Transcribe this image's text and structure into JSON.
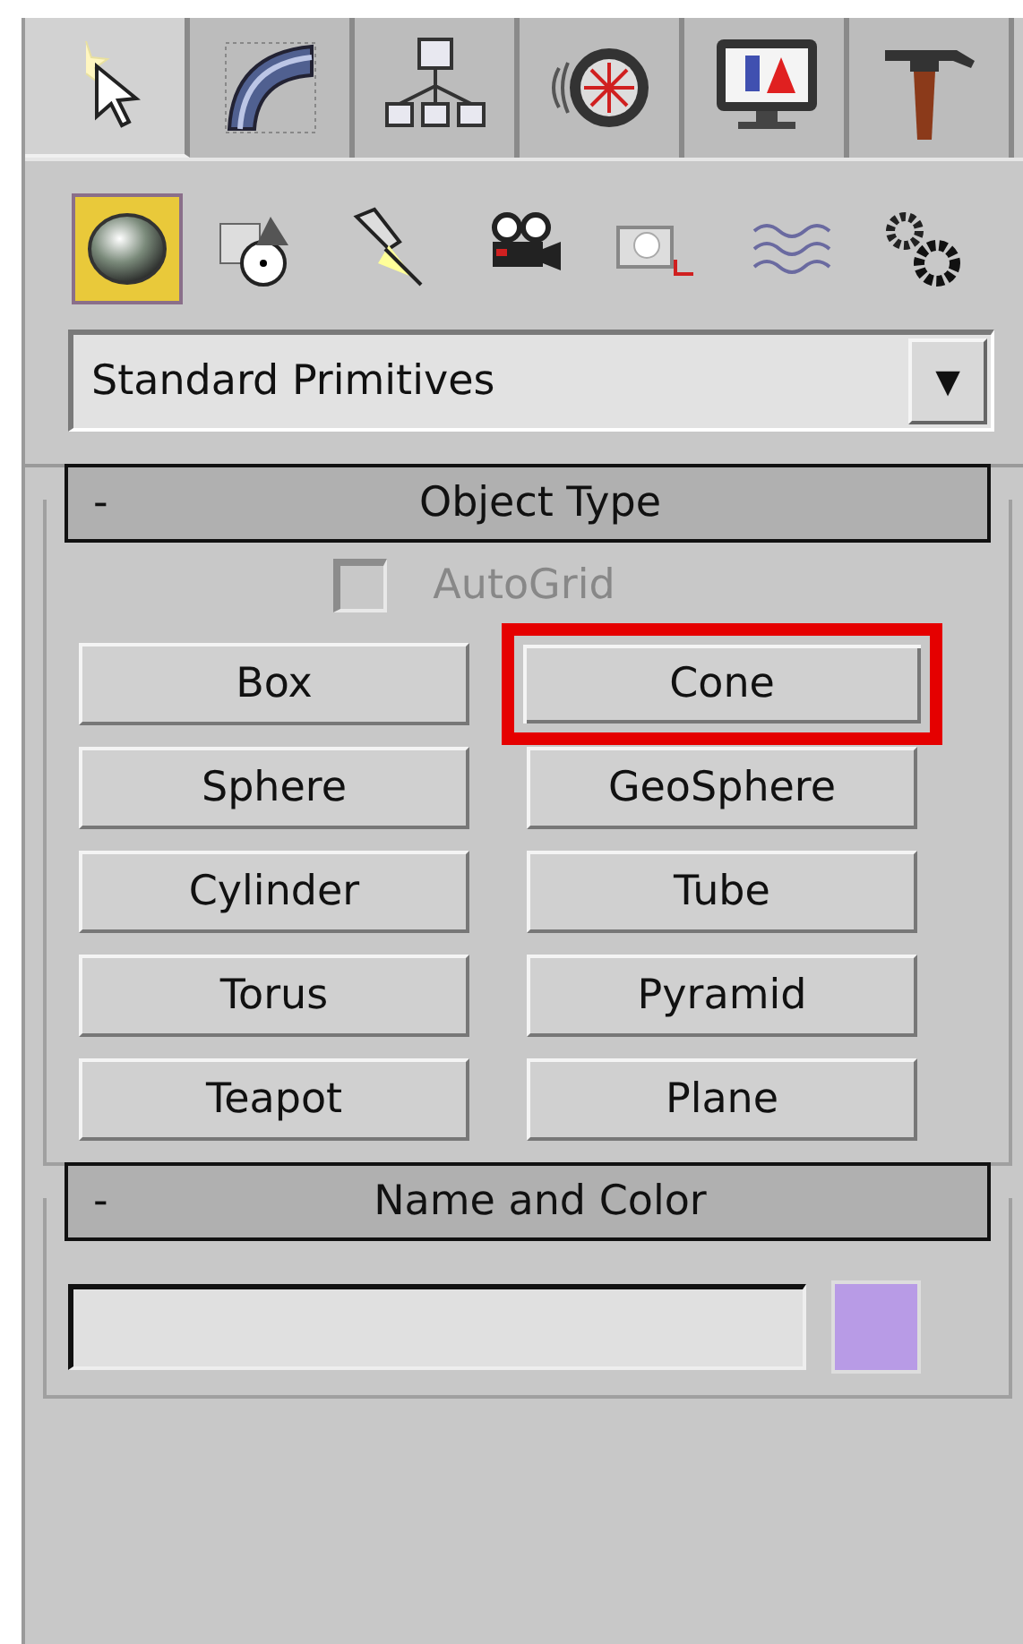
{
  "command_tabs": [
    {
      "selected": true
    },
    {
      "selected": false
    },
    {
      "selected": false
    },
    {
      "selected": false
    },
    {
      "selected": false
    },
    {
      "selected": false
    }
  ],
  "categories": [
    {
      "selected": true
    },
    {
      "selected": false
    },
    {
      "selected": false
    },
    {
      "selected": false
    },
    {
      "selected": false
    },
    {
      "selected": false
    },
    {
      "selected": false
    }
  ],
  "type_dropdown": {
    "value": "Standard Primitives",
    "arrow": "▼"
  },
  "rollouts": [
    {
      "kind": "object_type",
      "collapse": "-",
      "title": "Object Type",
      "autogrid": {
        "label": "AutoGrid",
        "checked": false,
        "disabled": true
      },
      "buttons": [
        {
          "label": "Box",
          "highlighted": false
        },
        {
          "label": "Cone",
          "highlighted": true
        },
        {
          "label": "Sphere",
          "highlighted": false
        },
        {
          "label": "GeoSphere",
          "highlighted": false
        },
        {
          "label": "Cylinder",
          "highlighted": false
        },
        {
          "label": "Tube",
          "highlighted": false
        },
        {
          "label": "Torus",
          "highlighted": false
        },
        {
          "label": "Pyramid",
          "highlighted": false
        },
        {
          "label": "Teapot",
          "highlighted": false
        },
        {
          "label": "Plane",
          "highlighted": false
        }
      ]
    },
    {
      "kind": "name_color",
      "collapse": "-",
      "title": "Name and Color",
      "color": "#b89be6"
    }
  ]
}
